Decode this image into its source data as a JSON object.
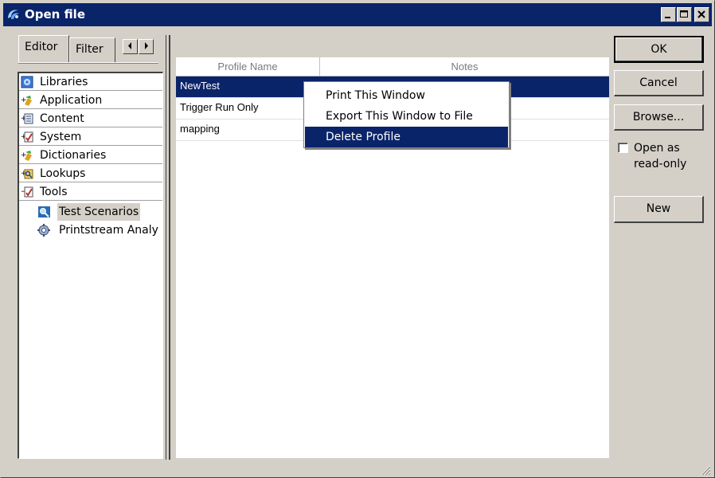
{
  "window": {
    "title": "Open file",
    "title_icon": "swirl-app-icon",
    "controls": {
      "minimize": "minimize-icon",
      "maximize": "maximize-icon",
      "close": "close-icon"
    }
  },
  "left_panel": {
    "tabs": [
      {
        "label": "Editor",
        "selected": true
      },
      {
        "label": "Filter",
        "selected": false
      }
    ],
    "tree": [
      {
        "label": "Libraries",
        "icon": "libraries-icon"
      },
      {
        "label": "Application",
        "icon": "application-icon"
      },
      {
        "label": "Content",
        "icon": "content-icon"
      },
      {
        "label": "System",
        "icon": "system-icon"
      },
      {
        "label": "Dictionaries",
        "icon": "dictionaries-icon"
      },
      {
        "label": "Lookups",
        "icon": "lookups-icon"
      },
      {
        "label": "Tools",
        "icon": "tools-icon"
      }
    ],
    "tools_children": [
      {
        "label": "Test Scenarios",
        "icon": "test-scenarios-icon",
        "selected": true
      },
      {
        "label": "Printstream Analy",
        "icon": "printstream-analyzer-icon",
        "selected": false
      }
    ]
  },
  "list": {
    "columns": [
      "Profile Name",
      "Notes"
    ],
    "rows": [
      {
        "name": "NewTest",
        "notes": "",
        "selected": true
      },
      {
        "name": "Trigger Run Only",
        "notes": "",
        "selected": false
      },
      {
        "name": "mapping",
        "notes": "",
        "selected": false
      }
    ]
  },
  "context_menu": {
    "items": [
      {
        "label": "Print This Window",
        "active": false
      },
      {
        "label": "Export This Window to File",
        "active": false
      },
      {
        "label": "Delete Profile",
        "active": true
      }
    ]
  },
  "buttons": {
    "ok": "OK",
    "cancel": "Cancel",
    "browse": "Browse...",
    "new": "New"
  },
  "readonly_checkbox": {
    "label": "Open as read-only",
    "checked": false
  },
  "colors": {
    "titlebar": "#0a246a",
    "face": "#d4d0c8",
    "selection": "#0a246a"
  }
}
